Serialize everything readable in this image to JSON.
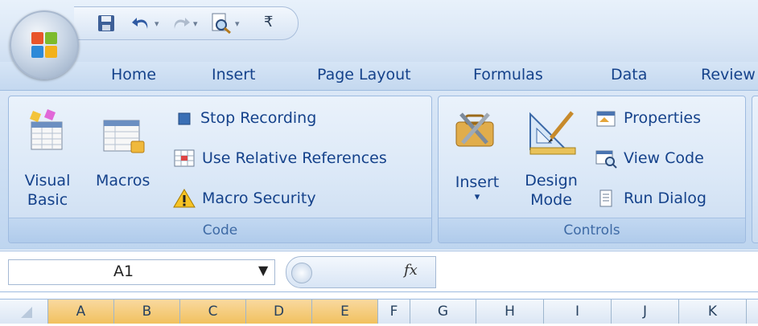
{
  "quick_access": {
    "icons": [
      "save-icon",
      "undo-icon",
      "redo-icon",
      "print-preview-icon",
      "customize-qat-icon"
    ],
    "customize_glyph": "₹"
  },
  "tabs": [
    "Home",
    "Insert",
    "Page Layout",
    "Formulas",
    "Data",
    "Review"
  ],
  "code_group": {
    "label": "Code",
    "visual_basic": {
      "line1": "Visual",
      "line2": "Basic"
    },
    "macros": "Macros",
    "stop_recording": "Stop Recording",
    "use_relative_references": "Use Relative References",
    "macro_security": "Macro Security"
  },
  "controls_group": {
    "label": "Controls",
    "insert": "Insert",
    "design_mode": {
      "line1": "Design",
      "line2": "Mode"
    },
    "properties": "Properties",
    "view_code": "View Code",
    "run_dialog": "Run Dialog"
  },
  "formula_bar": {
    "name_box": "A1",
    "fx_label": "fx",
    "formula_value": ""
  },
  "columns": {
    "headers": [
      "A",
      "B",
      "C",
      "D",
      "E",
      "F",
      "G",
      "H",
      "I",
      "J",
      "K"
    ],
    "selected": [
      "A",
      "B",
      "C",
      "D",
      "E"
    ]
  },
  "colors": {
    "tab_text": "#15428b",
    "selected_column": "#f1c15f"
  }
}
